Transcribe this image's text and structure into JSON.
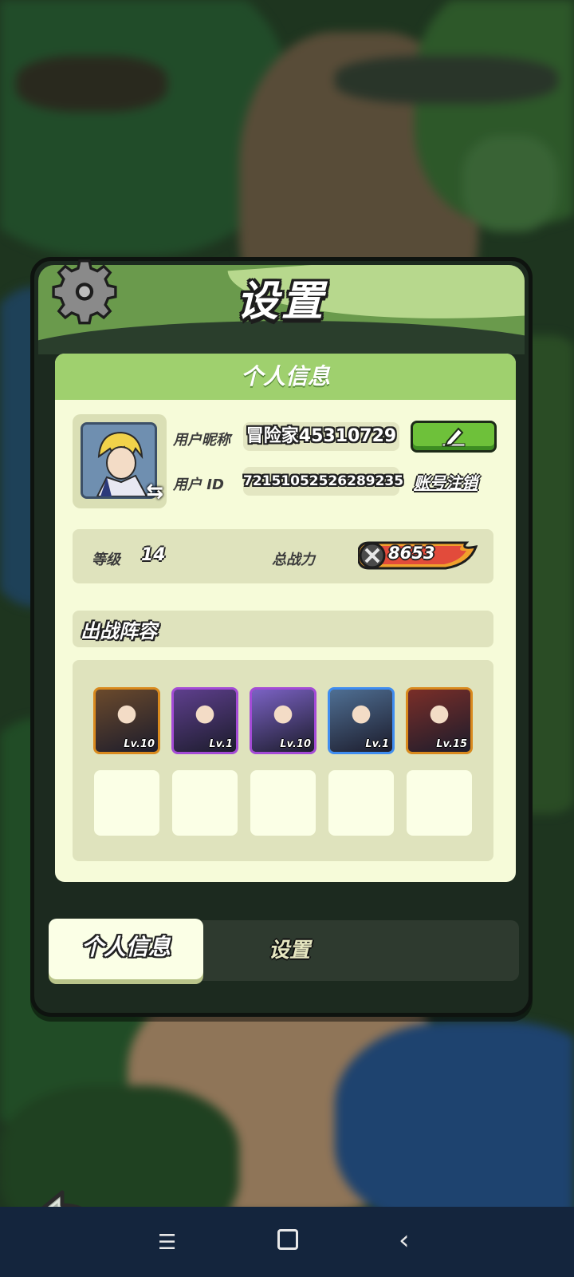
{
  "modal": {
    "title": "设置"
  },
  "profile": {
    "section_title": "个人信息",
    "nickname_label": "用户昵称",
    "nickname": "冒险家45310729",
    "id_label": "用户 ID",
    "user_id": "72151052526289235",
    "delete_account_label": "账号注销"
  },
  "stats": {
    "level_label": "等级",
    "level": "14",
    "power_label": "总战力",
    "power": "8653"
  },
  "lineup": {
    "title": "出战阵容",
    "heroes": [
      {
        "level": "Lv.10",
        "frame": "#d98a1e",
        "art": "#6b4a2c"
      },
      {
        "level": "Lv.1",
        "frame": "#a44bd6",
        "art": "#5e3f8d"
      },
      {
        "level": "Lv.10",
        "frame": "#a44bd6",
        "art": "#7b62c4"
      },
      {
        "level": "Lv.1",
        "frame": "#3f8df0",
        "art": "#4f6f93"
      },
      {
        "level": "Lv.15",
        "frame": "#d98a1e",
        "art": "#7a2e28"
      }
    ]
  },
  "tabs": {
    "active": "个人信息",
    "inactive": "设置"
  },
  "colors": {
    "accent_green": "#6ec13a",
    "card_bg": "#f6fbd9",
    "header_green": "#9fd06e"
  }
}
